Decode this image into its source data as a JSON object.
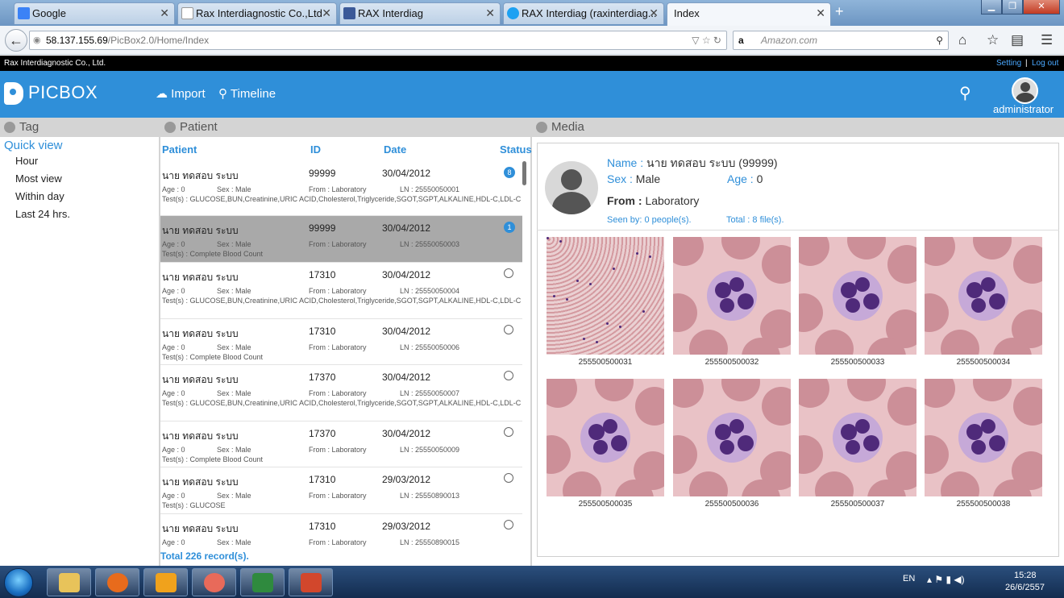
{
  "browser": {
    "tabs": [
      {
        "label": "Google",
        "favicon": "google-icon",
        "color": "#3b82f6"
      },
      {
        "label": "Rax Interdiagnostic Co.,Ltd",
        "favicon": "page-icon",
        "color": "#ffffff"
      },
      {
        "label": "RAX Interdiag",
        "favicon": "facebook-icon",
        "color": "#3b5998"
      },
      {
        "label": "RAX Interdiag (raxinterdiag...",
        "favicon": "twitter-icon",
        "color": "#1da1f2"
      },
      {
        "label": "Index",
        "favicon": "page-icon",
        "color": "#ffffff"
      }
    ],
    "url_host": "58.137.155.69",
    "url_path": "/PicBox2.0/Home/Index",
    "search_placeholder": "Amazon.com"
  },
  "topstrip": {
    "company": "Rax Interdiagnostic Co., Ltd.",
    "setting": "Setting",
    "separator": "|",
    "logout": "Log out"
  },
  "header": {
    "logo": "PICBOX",
    "import": "Import",
    "timeline": "Timeline",
    "user": "administrator",
    "brand_color": "#2f8fd9"
  },
  "tag_panel": {
    "title": "Tag",
    "quick_view": "Quick view",
    "items": [
      "Hour",
      "Most view",
      "Within day",
      "Last 24 hrs."
    ]
  },
  "patient_panel": {
    "title": "Patient",
    "columns": {
      "patient": "Patient",
      "id": "ID",
      "date": "Date",
      "status": "Status"
    },
    "rows": [
      {
        "name": "นาย ทดสอบ ระบบ",
        "id": "99999",
        "date": "30/04/2012",
        "age": "Age : 0",
        "sex": "Sex : Male",
        "from": "From : Laboratory",
        "ln": "LN : 25550050001",
        "tests": "Test(s) : GLUCOSE,BUN,Creatinine,URIC ACID,Cholesterol,Triglyceride,SGOT,SGPT,ALKALINE,HDL-C,LDL-C",
        "status": "8"
      },
      {
        "name": "นาย ทดสอบ ระบบ",
        "id": "99999",
        "date": "30/04/2012",
        "age": "Age : 0",
        "sex": "Sex : Male",
        "from": "From : Laboratory",
        "ln": "LN : 25550050003",
        "tests": "Test(s) : Complete Blood Count",
        "status": "1"
      },
      {
        "name": "นาย ทดสอบ ระบบ",
        "id": "17310",
        "date": "30/04/2012",
        "age": "Age : 0",
        "sex": "Sex : Male",
        "from": "From : Laboratory",
        "ln": "LN : 25550050004",
        "tests": "Test(s) : GLUCOSE,BUN,Creatinine,URIC ACID,Cholesterol,Triglyceride,SGOT,SGPT,ALKALINE,HDL-C,LDL-C",
        "status": ""
      },
      {
        "name": "นาย ทดสอบ ระบบ",
        "id": "17310",
        "date": "30/04/2012",
        "age": "Age : 0",
        "sex": "Sex : Male",
        "from": "From : Laboratory",
        "ln": "LN : 25550050006",
        "tests": "Test(s) : Complete Blood Count",
        "status": ""
      },
      {
        "name": "นาย ทดสอบ ระบบ",
        "id": "17370",
        "date": "30/04/2012",
        "age": "Age : 0",
        "sex": "Sex : Male",
        "from": "From : Laboratory",
        "ln": "LN : 25550050007",
        "tests": "Test(s) : GLUCOSE,BUN,Creatinine,URIC ACID,Cholesterol,Triglyceride,SGOT,SGPT,ALKALINE,HDL-C,LDL-C",
        "status": ""
      },
      {
        "name": "นาย ทดสอบ ระบบ",
        "id": "17370",
        "date": "30/04/2012",
        "age": "Age : 0",
        "sex": "Sex : Male",
        "from": "From : Laboratory",
        "ln": "LN : 25550050009",
        "tests": "Test(s) : Complete Blood Count",
        "status": ""
      },
      {
        "name": "นาย ทดสอบ ระบบ",
        "id": "17310",
        "date": "29/03/2012",
        "age": "Age : 0",
        "sex": "Sex : Male",
        "from": "From : Laboratory",
        "ln": "LN : 25550890013",
        "tests": "Test(s) : GLUCOSE",
        "status": ""
      },
      {
        "name": "นาย ทดสอบ ระบบ",
        "id": "17310",
        "date": "29/03/2012",
        "age": "Age : 0",
        "sex": "Sex : Male",
        "from": "From : Laboratory",
        "ln": "LN : 25550890015",
        "tests": "",
        "status": ""
      }
    ],
    "total": "Total 226 record(s)."
  },
  "media_panel": {
    "title": "Media",
    "name_label": "Name :",
    "name_value": "นาย ทดสอบ ระบบ (99999)",
    "sex_label": "Sex :",
    "sex_value": "Male",
    "age_label": "Age :",
    "age_value": "0",
    "from_label": "From :",
    "from_value": "Laboratory",
    "seen_by": "Seen by: 0 people(s).",
    "total_files": "Total : 8 file(s).",
    "images": [
      "255500500031",
      "255500500032",
      "255500500033",
      "255500500034",
      "255500500035",
      "255500500036",
      "255500500037",
      "255500500038"
    ]
  },
  "taskbar": {
    "apps": [
      "explorer-icon",
      "firefox-icon",
      "outlook-icon",
      "media-icon",
      "excel-icon",
      "powerpoint-icon"
    ],
    "lang": "EN",
    "time": "15:28",
    "date": "26/6/2557"
  }
}
